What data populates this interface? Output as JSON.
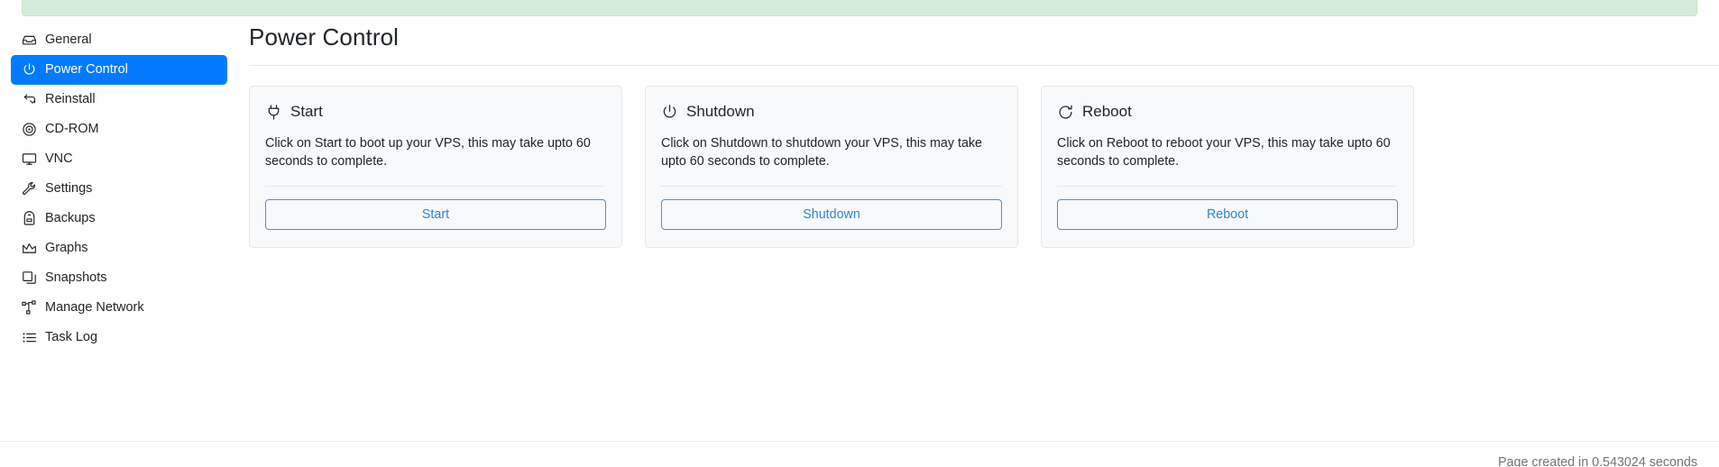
{
  "alert": {
    "text": "",
    "background": "#d4edda",
    "border": "#c3e6cb",
    "text_color": "#155724"
  },
  "theme": {
    "accent": "#007bff",
    "link": "#2f82d8",
    "card_bg": "#f8f9fa",
    "card_border": "#e4e7ea",
    "muted_text": "#6c757d"
  },
  "sidebar": {
    "items": [
      {
        "label": "General",
        "icon": "inbox-icon",
        "active": false
      },
      {
        "label": "Power Control",
        "icon": "power-icon",
        "active": true
      },
      {
        "label": "Reinstall",
        "icon": "reinstall-icon",
        "active": false
      },
      {
        "label": "CD-ROM",
        "icon": "disc-icon",
        "active": false
      },
      {
        "label": "VNC",
        "icon": "monitor-icon",
        "active": false
      },
      {
        "label": "Settings",
        "icon": "wrench-icon",
        "active": false
      },
      {
        "label": "Backups",
        "icon": "backpack-icon",
        "active": false
      },
      {
        "label": "Graphs",
        "icon": "chart-area-icon",
        "active": false
      },
      {
        "label": "Snapshots",
        "icon": "copy-icon",
        "active": false
      },
      {
        "label": "Manage Network",
        "icon": "network-nodes-icon",
        "active": false
      },
      {
        "label": "Task Log",
        "icon": "list-icon",
        "active": false
      }
    ]
  },
  "main": {
    "title": "Power Control",
    "cards": [
      {
        "title": "Start",
        "icon": "plug-icon",
        "description": "Click on Start to boot up your VPS, this may take upto 60 seconds to complete.",
        "button_label": "Start"
      },
      {
        "title": "Shutdown",
        "icon": "power-icon",
        "description": "Click on Shutdown to shutdown your VPS, this may take upto 60 seconds to complete.",
        "button_label": "Shutdown"
      },
      {
        "title": "Reboot",
        "icon": "refresh-icon",
        "description": "Click on Reboot to reboot your VPS, this may take upto 60 seconds to complete.",
        "button_label": "Reboot"
      }
    ]
  },
  "footer": {
    "note": "Page created in 0.543024 seconds"
  }
}
